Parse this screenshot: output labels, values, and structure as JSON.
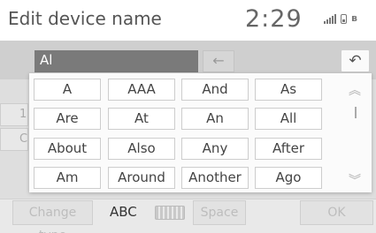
{
  "header": {
    "title": "Edit device name",
    "clock": "2:29"
  },
  "input": {
    "value": "Al",
    "backspace_icon": "backspace-arrow-icon"
  },
  "undo_icon": "undo-arrow-icon",
  "background_keys": [
    "1",
    "C"
  ],
  "candidates": {
    "rows": [
      [
        "A",
        "AAA",
        "And",
        "As"
      ],
      [
        "Are",
        "At",
        "An",
        "All"
      ],
      [
        "About",
        "Also",
        "Any",
        "After"
      ],
      [
        "Am",
        "Around",
        "Another",
        "Ago"
      ]
    ]
  },
  "bottom": {
    "change_type": "Change type",
    "mode": "ABC",
    "space": "Space",
    "ok": "OK"
  },
  "colors": {
    "field_bg": "#7a7a7a",
    "panel_bg": "#fbfbfb",
    "disabled_text": "#bdbdbd"
  }
}
